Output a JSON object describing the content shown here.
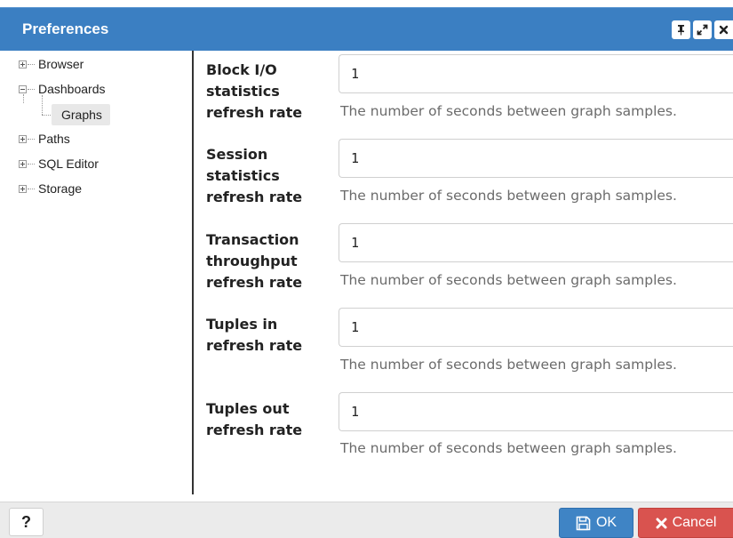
{
  "dialog": {
    "title": "Preferences",
    "accent_color": "#3b7fc2",
    "title_buttons": [
      {
        "name": "pin-icon"
      },
      {
        "name": "maximize-icon"
      },
      {
        "name": "close-icon"
      }
    ]
  },
  "tree": {
    "items": [
      {
        "label": "Browser",
        "state": "collapsed"
      },
      {
        "label": "Dashboards",
        "state": "expanded"
      },
      {
        "label": "Graphs",
        "state": "selected"
      },
      {
        "label": "Paths",
        "state": "collapsed"
      },
      {
        "label": "SQL Editor",
        "state": "collapsed"
      },
      {
        "label": "Storage",
        "state": "collapsed"
      }
    ]
  },
  "fields": [
    {
      "label": "Block I/O statistics refresh rate",
      "value": "1",
      "help": "The number of seconds between graph samples."
    },
    {
      "label": "Session statistics refresh rate",
      "value": "1",
      "help": "The number of seconds between graph samples."
    },
    {
      "label": "Transaction throughput refresh rate",
      "value": "1",
      "help": "The number of seconds between graph samples."
    },
    {
      "label": "Tuples in refresh rate",
      "value": "1",
      "help": "The number of seconds between graph samples."
    },
    {
      "label": "Tuples out refresh rate",
      "value": "1",
      "help": "The number of seconds between graph samples."
    }
  ],
  "footer": {
    "help_label": "?",
    "ok_label": "OK",
    "cancel_label": "Cancel",
    "ok_color": "#3f84c5",
    "cancel_color": "#d9534f"
  }
}
